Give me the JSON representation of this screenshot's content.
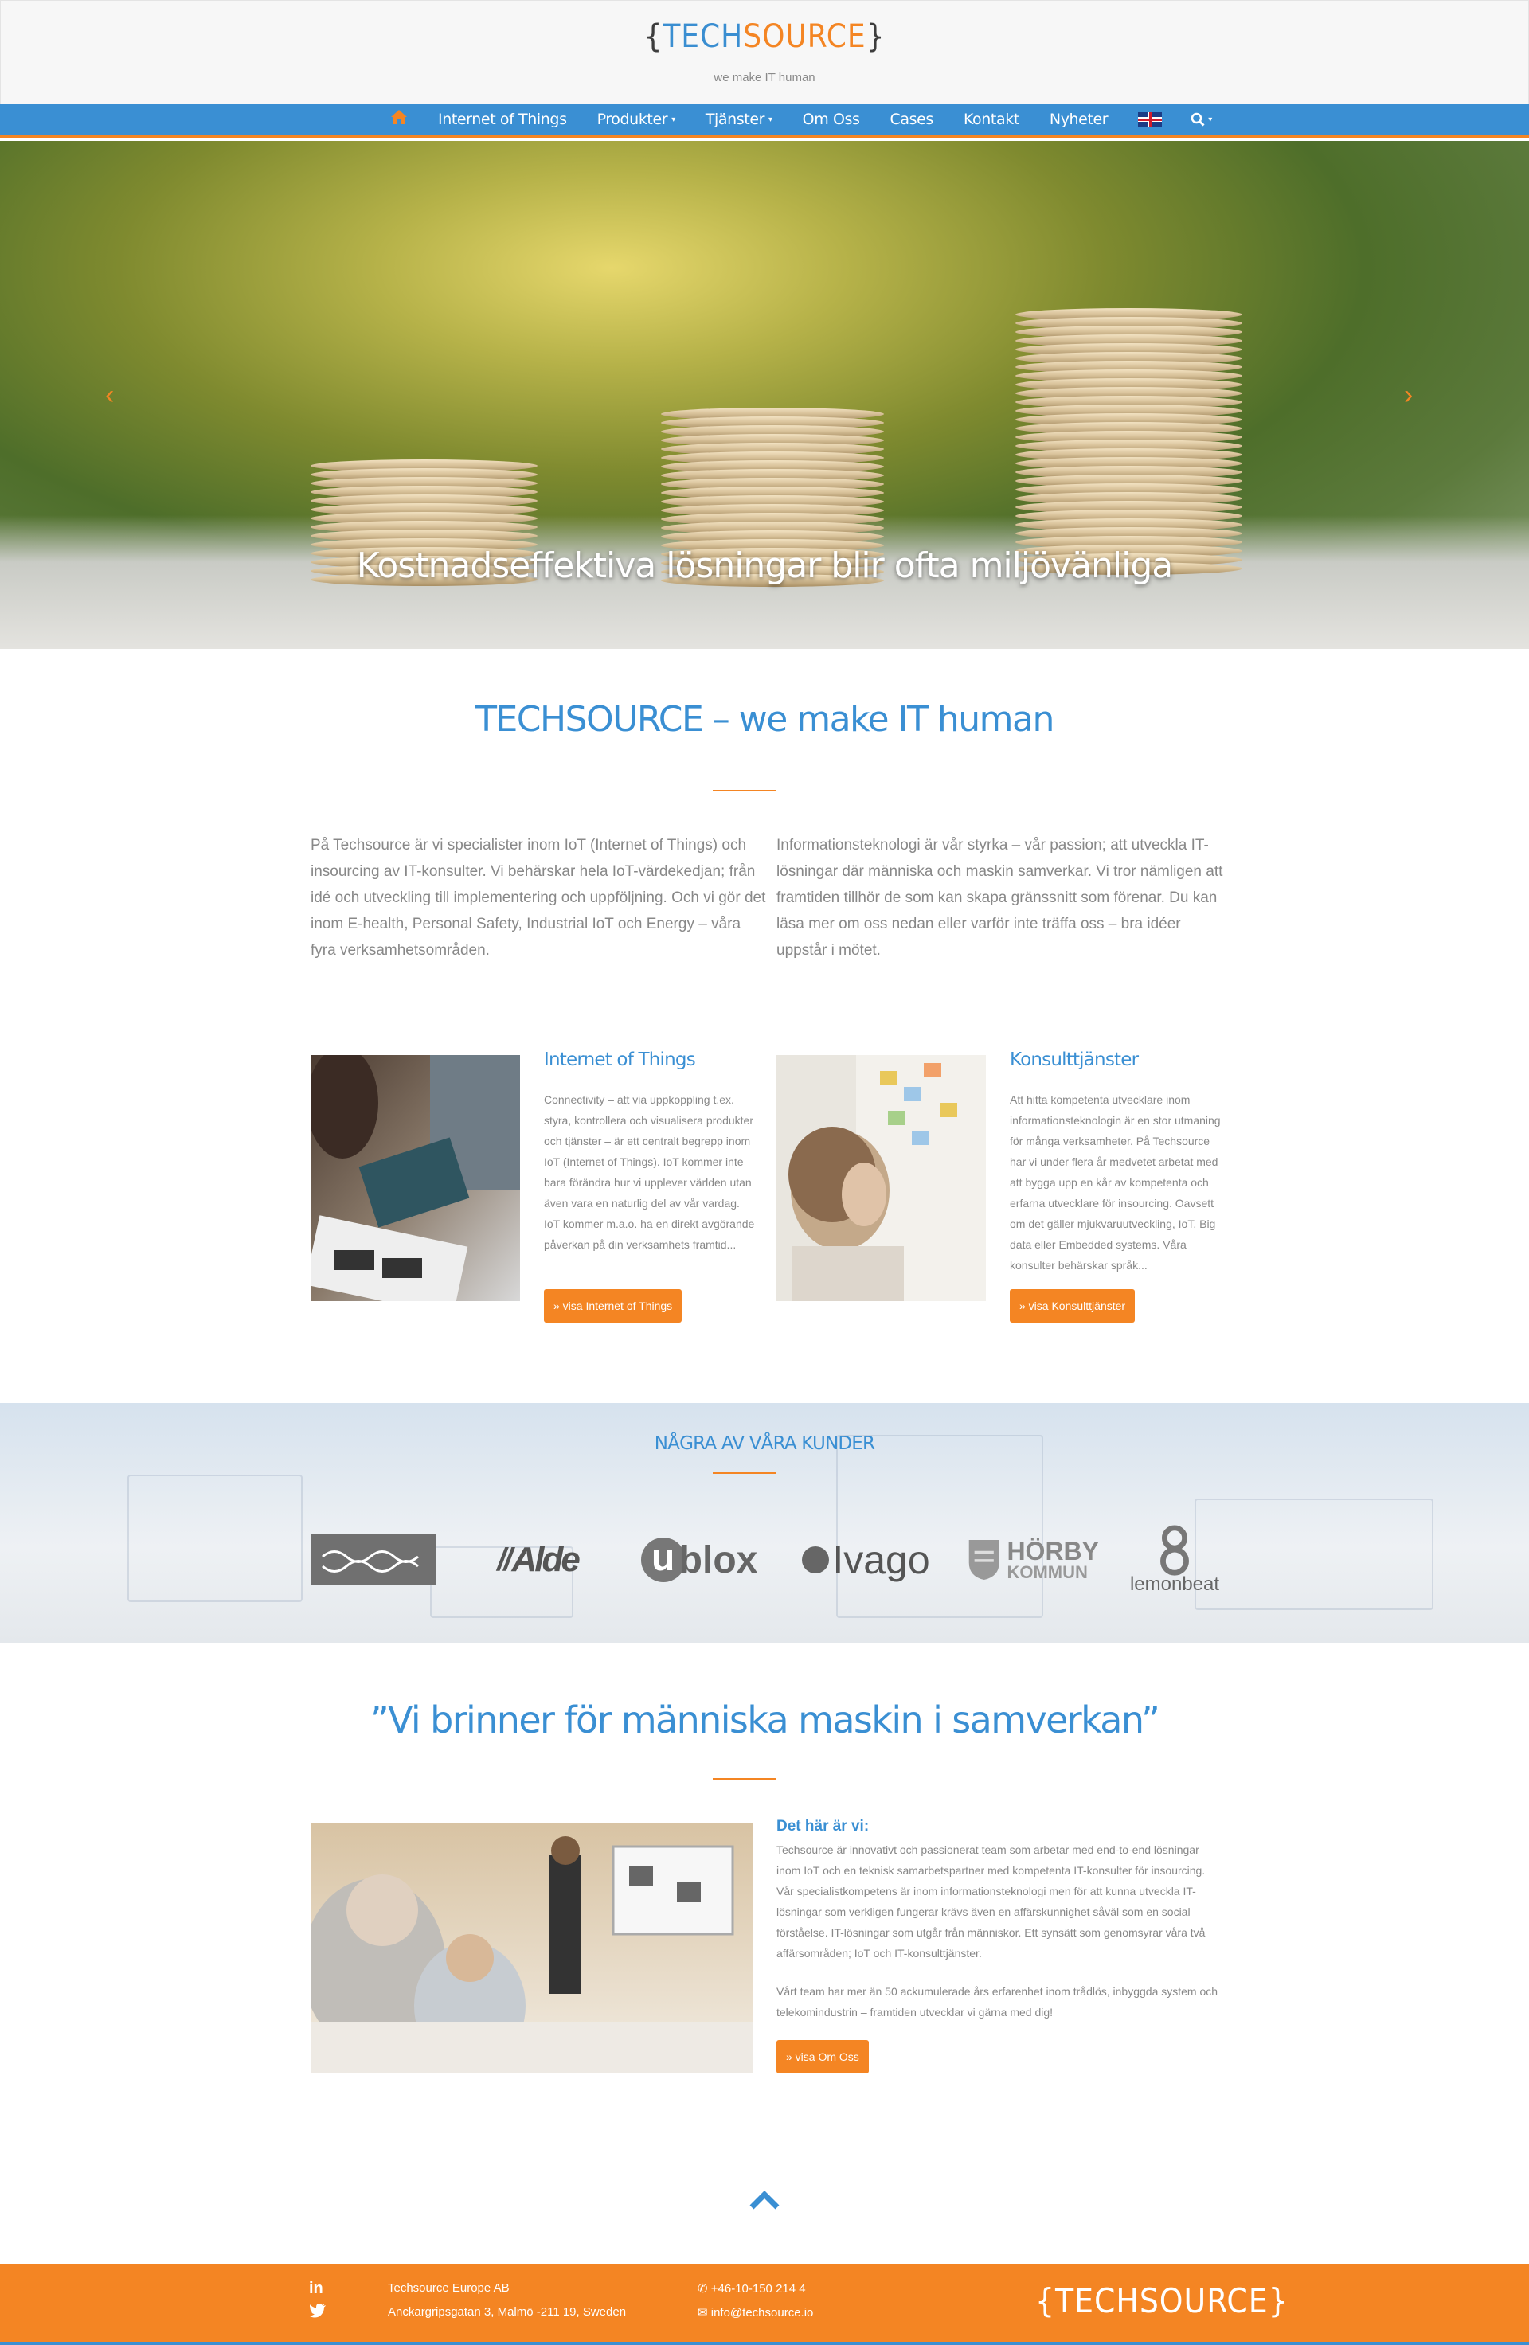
{
  "header": {
    "logo_open": "{",
    "logo_tech": "TECH",
    "logo_source": "SOURCE",
    "logo_close": "}",
    "tagline": "we make IT human"
  },
  "nav": {
    "home_icon": "home-icon",
    "items": [
      {
        "label": "Internet of Things",
        "dropdown": false
      },
      {
        "label": "Produkter",
        "dropdown": true
      },
      {
        "label": "Tjänster",
        "dropdown": true
      },
      {
        "label": "Om Oss",
        "dropdown": false
      },
      {
        "label": "Cases",
        "dropdown": false
      },
      {
        "label": "Kontakt",
        "dropdown": false
      },
      {
        "label": "Nyheter",
        "dropdown": false
      }
    ],
    "language_icon": "uk-flag-icon",
    "search_icon": "search-icon"
  },
  "hero": {
    "caption": "Kostnadseffektiva lösningar blir ofta miljövänliga",
    "prev_icon": "chevron-left-icon",
    "next_icon": "chevron-right-icon"
  },
  "intro": {
    "title": "TECHSOURCE – we make IT human",
    "col1": "På Techsource är vi specialister inom IoT (Internet of Things) och insourcing av IT-konsulter. Vi behärskar hela IoT-värdekedjan; från idé och utveckling till implementering och uppföljning. Och vi gör det inom E-health, Personal Safety, Industrial IoT och Energy – våra fyra verksamhetsområden.",
    "col2": "Informationsteknologi är vår styrka –  vår passion; att utveckla IT-lösningar där människa och maskin samverkar. Vi tror nämligen att framtiden tillhör de som kan skapa gränssnitt som förenar. Du kan läsa mer om oss nedan eller varför inte träffa oss – bra idéer uppstår i mötet."
  },
  "cards": [
    {
      "title": "Internet of Things",
      "text": "Connectivity – att via uppkoppling t.ex. styra, kontrollera och visualisera produkter och tjänster – är ett centralt begrepp inom IoT (Internet of Things). IoT kommer inte bara förändra hur vi upplever världen utan även vara en naturlig del av vår vardag. IoT kommer m.a.o. ha en direkt avgörande påverkan på din verksamhets framtid...",
      "button": "» visa Internet of Things"
    },
    {
      "title": "Konsulttjänster",
      "text": "Att hitta kompetenta utvecklare inom informationsteknologin är en stor utmaning för många verksamheter. På Techsource har vi under flera år medvetet arbetat med att bygga upp en kår av kompetenta och erfarna utvecklare för insourcing. Oavsett om det gäller mjukvaruutveckling, IoT, Big data eller Embedded systems. Våra konsulter behärskar språk...",
      "button": "» visa Konsulttjänster"
    }
  ],
  "clients": {
    "title": "NÅGRA AV VÅRA KUNDER",
    "logos": [
      "Alfa Laval",
      "Alde",
      "ublox",
      "Ivago",
      "HÖRBY KOMMUN",
      "lemonbeat"
    ],
    "alde": "Alde",
    "ublox_u": "u",
    "ublox_rest": "blox",
    "ivago": "Ivago",
    "horby_1": "HÖRBY",
    "horby_2": "KOMMUN",
    "lemonbeat": "lemonbeat",
    "alfa": "alfa laval"
  },
  "about": {
    "quote": "”Vi brinner för människa maskin i samverkan”",
    "title": "Det här är vi:",
    "p1": "Techsource är innovativt och passionerat team som arbetar med end-to-end lösningar inom IoT och en teknisk samarbetspartner med kompetenta IT-konsulter för insourcing. Vår specialistkompetens är inom informationsteknologi men för att kunna utveckla IT-lösningar som verkligen fungerar krävs även en affärskunnighet såväl som en social förståelse. IT-lösningar som utgår från människor. Ett synsätt som genomsyrar våra två affärsområden; IoT och IT-konsulttjänster.",
    "p2": "Vårt team har mer än 50 ackumulerade års erfarenhet inom trådlös, inbyggda system och telekomindustrin – framtiden utvecklar vi gärna med dig!",
    "button": "» visa Om Oss"
  },
  "footer": {
    "company": "Techsource Europe AB",
    "address": "Anckargripsgatan 3, Malmö -211 19, Sweden",
    "phone": "+46-10-150 214 4",
    "email": "info@techsource.io",
    "linkedin": "in",
    "logo_open": "{",
    "logo_tech": "TECH",
    "logo_source": "SOURCE",
    "logo_close": "}"
  },
  "colors": {
    "brand_blue": "#3a8fd3",
    "brand_orange": "#f48523"
  }
}
